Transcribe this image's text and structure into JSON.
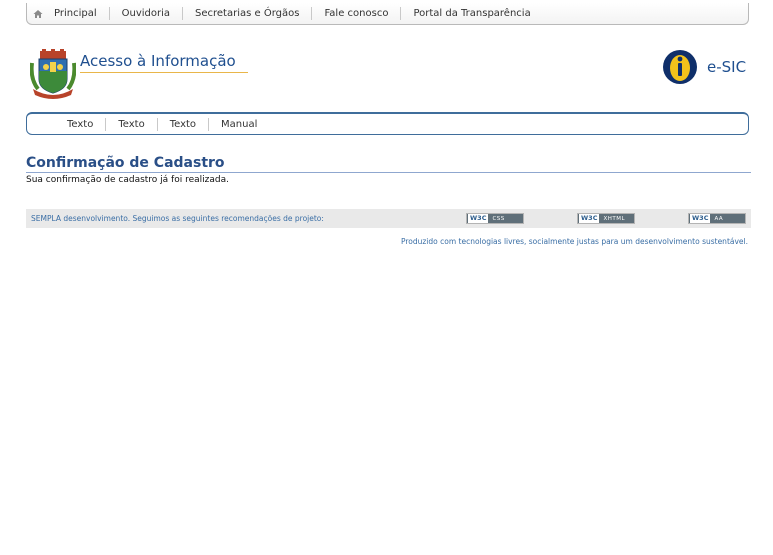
{
  "top_nav": {
    "items": [
      "Principal",
      "Ouvidoria",
      "Secretarias e Órgãos",
      "Fale conosco",
      "Portal da Transparência"
    ]
  },
  "header": {
    "site_title": "Acesso à Informação",
    "esic_label": "e-SIC"
  },
  "sub_nav": {
    "items": [
      "Texto",
      "Texto",
      "Texto",
      "Manual"
    ]
  },
  "main": {
    "title": "Confirmação de Cadastro",
    "message": "Sua confirmação de cadastro já foi realizada."
  },
  "footer": {
    "text": "SEMPLA desenvolvimento. Seguimos as seguintes recomendações de projeto:",
    "badges": [
      {
        "w3c": "W3C",
        "label": "CSS"
      },
      {
        "w3c": "W3C",
        "label": "XHTML"
      },
      {
        "w3c": "W3C",
        "label": "AA"
      }
    ],
    "tagline": "Produzido com tecnologias livres, socialmente justas para um desenvolvimento sustentável."
  },
  "colors": {
    "title_blue": "#2a4f87",
    "link_blue": "#3a6ea5",
    "accent_gold": "#e9b64a",
    "nav_border": "#3f6d9b"
  }
}
